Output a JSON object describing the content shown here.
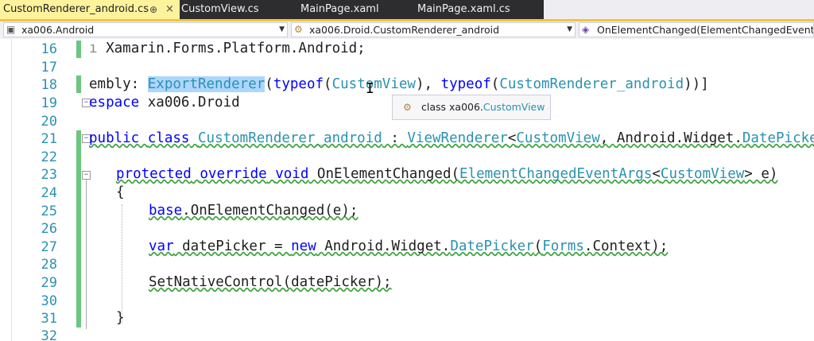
{
  "tabs": [
    {
      "label": "CustomRenderer_android.cs",
      "active": true,
      "pin_glyph": "⊕",
      "close_glyph": "×"
    },
    {
      "label": "CustomView.cs"
    },
    {
      "label": "MainPage.xaml"
    },
    {
      "label": "MainPage.xaml.cs"
    }
  ],
  "navbar": {
    "project": "xa006.Android",
    "class": "xa006.Droid.CustomRenderer_android",
    "member": "OnElementChanged(ElementChangedEventA"
  },
  "line_numbers": [
    "16",
    "17",
    "18",
    "19",
    "20",
    "21",
    "22",
    "23",
    "24",
    "25",
    "26",
    "27",
    "28",
    "29",
    "30",
    "31",
    "32"
  ],
  "code": {
    "l16": "Xamarin.Forms.Platform.Android;",
    "l18": {
      "pre": "embly: ",
      "attr": "ExportRenderer",
      "p1": "(",
      "kw1": "typeof",
      "p2": "(",
      "t1": "CustomView",
      "p3": "), ",
      "kw2": "typeof",
      "p4": "(",
      "t2": "CustomRenderer_android",
      "p5": "))]"
    },
    "l19": {
      "kw": "espace",
      "rest": " xa006.Droid"
    },
    "l21": {
      "kw1": "public",
      "kw2": "class",
      "t1": "CustomRenderer_android",
      "p1": " : ",
      "t2": "ViewRenderer",
      "p2": "<",
      "t3": "CustomView",
      "p3": ", Android.Widget.",
      "t4": "DatePicker",
      "p4": ">"
    },
    "l23": {
      "kw1": "protected",
      "kw2": "override",
      "kw3": "void",
      "m": " OnElementChanged(",
      "t1": "ElementChangedEventArgs",
      "p1": "<",
      "t2": "CustomView",
      "p2": "> e)"
    },
    "l24": "{",
    "l25": {
      "kw": "base",
      "rest": ".OnElementChanged(e);"
    },
    "l27": {
      "kw1": "var",
      "mid": " datePicker = ",
      "kw2": "new",
      "p1": " Android.Widget.",
      "t1": "DatePicker",
      "p2": "(",
      "t2": "Forms",
      "p3": ".Context);"
    },
    "l29": "SetNativeControl(datePicker);",
    "l31": "}"
  },
  "tooltip": {
    "kind": "class",
    "ns": "xa006.",
    "name": "CustomView",
    "icon": "class-icon"
  },
  "colors": {
    "keyword": "#0000ff",
    "type": "#2b91af",
    "active_tab": "#fff29d",
    "change_bar": "#6cc67f",
    "selection": "#add6ff"
  }
}
